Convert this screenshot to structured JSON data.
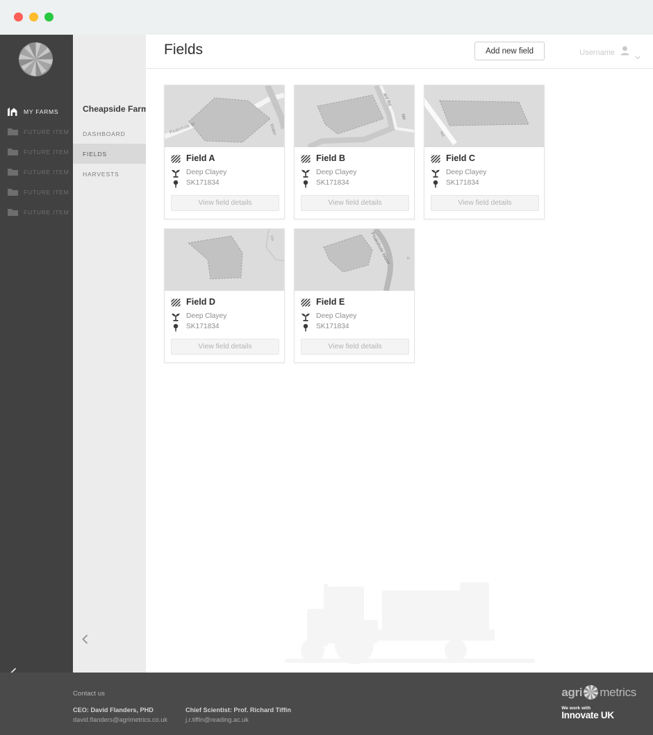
{
  "window": {
    "traffic_lights": [
      {
        "name": "close",
        "color": "#ff5f57"
      },
      {
        "name": "minimize",
        "color": "#febc2e"
      },
      {
        "name": "zoom",
        "color": "#28c840"
      }
    ]
  },
  "sidebar": {
    "logo_name": "agrimetrics-pinwheel-logo",
    "items": [
      {
        "label": "MY FARMS",
        "icon": "farm-icon",
        "state": "active"
      },
      {
        "label": "FUTURE ITEM",
        "icon": "folder-icon",
        "state": "future"
      },
      {
        "label": "FUTURE ITEM",
        "icon": "folder-icon",
        "state": "future"
      },
      {
        "label": "FUTURE ITEM",
        "icon": "folder-icon",
        "state": "future"
      },
      {
        "label": "FUTURE ITEM",
        "icon": "folder-icon",
        "state": "future"
      },
      {
        "label": "FUTURE ITEM",
        "icon": "folder-icon",
        "state": "future"
      }
    ],
    "collapse_icon": "chevron-left-icon"
  },
  "subsidebar": {
    "farm_name": "Cheapside Farm",
    "items": [
      {
        "label": "DASHBOARD",
        "selected": false
      },
      {
        "label": "FIELDS",
        "selected": true
      },
      {
        "label": "HARVESTS",
        "selected": false
      }
    ],
    "collapse_icon": "chevron-left-icon"
  },
  "header": {
    "title": "Fields",
    "add_button": "Add new field",
    "username": "Username",
    "user_icon": "user-avatar-icon",
    "chevron_icon": "chevron-down-icon"
  },
  "fields": [
    {
      "name": "Field A",
      "soil": "Deep Clayey",
      "grid_ref": "SK171834",
      "details_label": "View field details",
      "map_labels": [
        "Peakshole Water"
      ],
      "shape": "hexagon"
    },
    {
      "name": "Field B",
      "soil": "Deep Clayey",
      "grid_ref": "SK171834",
      "details_label": "View field details",
      "map_labels": [
        "ard Rd"
      ],
      "shape": "quad"
    },
    {
      "name": "Field C",
      "soil": "Deep Clayey",
      "grid_ref": "SK171834",
      "details_label": "View field details",
      "map_labels": [],
      "shape": "parallelogram"
    },
    {
      "name": "Field D",
      "soil": "Deep Clayey",
      "grid_ref": "SK171834",
      "details_label": "View field details",
      "map_labels": [],
      "shape": "blob"
    },
    {
      "name": "Field E",
      "soil": "Deep Clayey",
      "grid_ref": "SK171834",
      "details_label": "View field details",
      "map_labels": [
        "Peakshole Water"
      ],
      "shape": "leaf"
    }
  ],
  "card_icons": {
    "field": "field-hatch-icon",
    "soil": "soil-plant-icon",
    "location": "map-pin-icon"
  },
  "footer": {
    "contact_label": "Contact us",
    "people": [
      {
        "role": "CEO: David Flanders, PHD",
        "email": "david.flanders@agrimetrics.co.uk"
      },
      {
        "role": "Chief Scientist: Prof. Richard Tiffin",
        "email": "j.r.tiffin@reading.ac.uk"
      }
    ],
    "logo_agri": "agri",
    "logo_metrics": "metrics",
    "innovate_small": "We work with",
    "innovate_big": "Innovate UK"
  },
  "colors": {
    "sidebar_dark": "#414141",
    "sidebar_light": "#ececec",
    "footer": "#4a4a4a",
    "titlebar": "#edf1f2",
    "map_bg": "#dcdcdc",
    "selected": "#d9d9d9"
  }
}
